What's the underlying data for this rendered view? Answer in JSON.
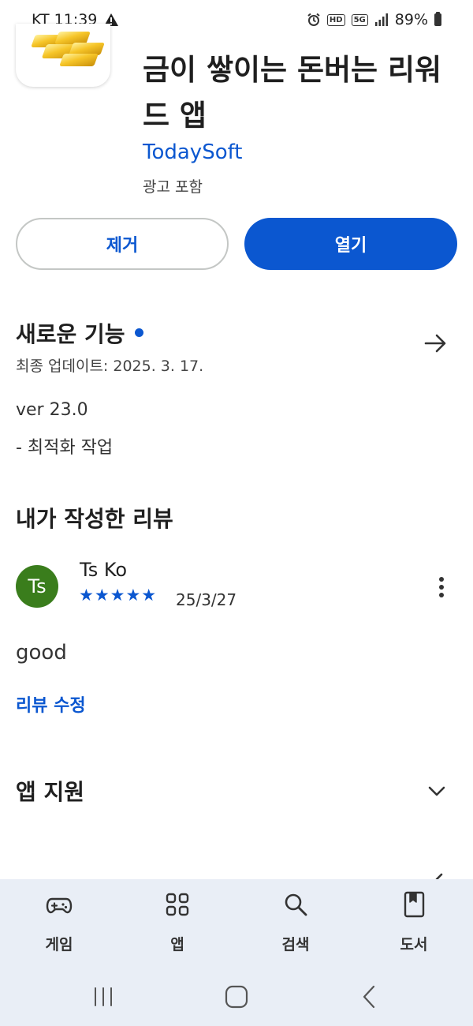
{
  "status_bar": {
    "carrier_time": "KT 11:39",
    "warning_icon": "warning-icon",
    "hd_label": "HD",
    "net_label": "5G",
    "battery": "89%"
  },
  "app": {
    "title": "금이 쌓이는 돈버는 리워드 앱",
    "developer": "TodaySoft",
    "ads_note": "광고 포함",
    "icon": "gold-bars-icon"
  },
  "buttons": {
    "remove_label": "제거",
    "open_label": "열기"
  },
  "whats_new": {
    "title": "새로운 기능",
    "updated": "최종 업데이트: 2025. 3. 17.",
    "version": "ver 23.0",
    "note": "- 최적화 작업"
  },
  "my_review": {
    "title": "내가 작성한 리뷰",
    "avatar_initials": "Ts",
    "reviewer_name": "Ts Ko",
    "rating": 5,
    "stars": "★★★★★",
    "date": "25/3/27",
    "text": "good",
    "edit_label": "리뷰 수정"
  },
  "app_support": {
    "title": "앱 지원"
  },
  "bottom_nav": {
    "items": [
      {
        "label": "게임",
        "icon": "gamepad-icon"
      },
      {
        "label": "앱",
        "icon": "apps-grid-icon"
      },
      {
        "label": "검색",
        "icon": "search-icon"
      },
      {
        "label": "도서",
        "icon": "book-icon"
      }
    ]
  },
  "colors": {
    "accent": "#0b57d0",
    "avatar": "#3a7d1c",
    "nav_bg": "#e9eef6"
  }
}
